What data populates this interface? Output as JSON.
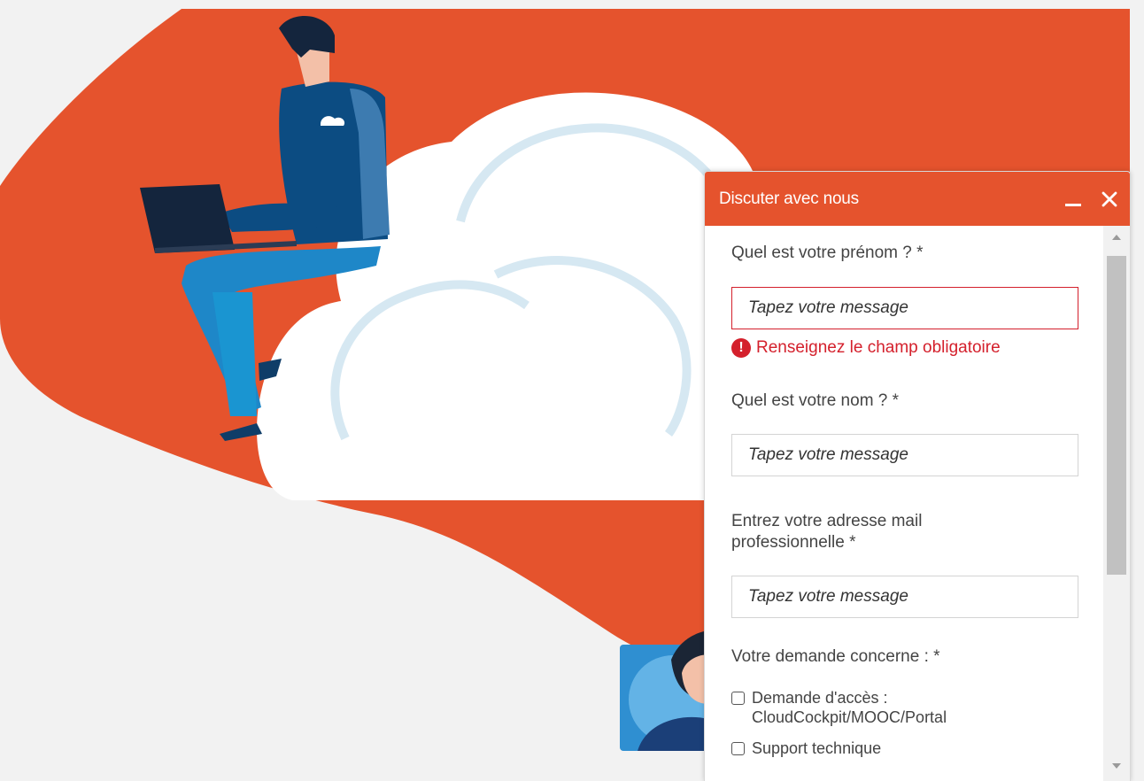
{
  "colors": {
    "brand_orange": "#e5532d",
    "error_red": "#d4202c",
    "background": "#f2f2f2"
  },
  "chat": {
    "title": "Discuter avec nous",
    "minimize_icon": "minimize-icon",
    "close_icon": "close-icon",
    "questions": {
      "first_name": {
        "label": "Quel est votre prénom ? *",
        "placeholder": "Tapez votre message",
        "error": "Renseignez le champ obligatoire"
      },
      "last_name": {
        "label": "Quel est votre nom ? *",
        "placeholder": "Tapez votre message"
      },
      "email": {
        "label_line1": "Entrez votre adresse mail",
        "label_line2": "professionnelle *",
        "placeholder": "Tapez votre message"
      },
      "request": {
        "label": "Votre demande concerne : *",
        "options": [
          {
            "line1": "Demande d'accès :",
            "line2": "CloudCockpit/MOOC/Portal",
            "checked": false
          },
          {
            "line1": "Support technique",
            "line2": "",
            "checked": false
          }
        ]
      }
    }
  }
}
